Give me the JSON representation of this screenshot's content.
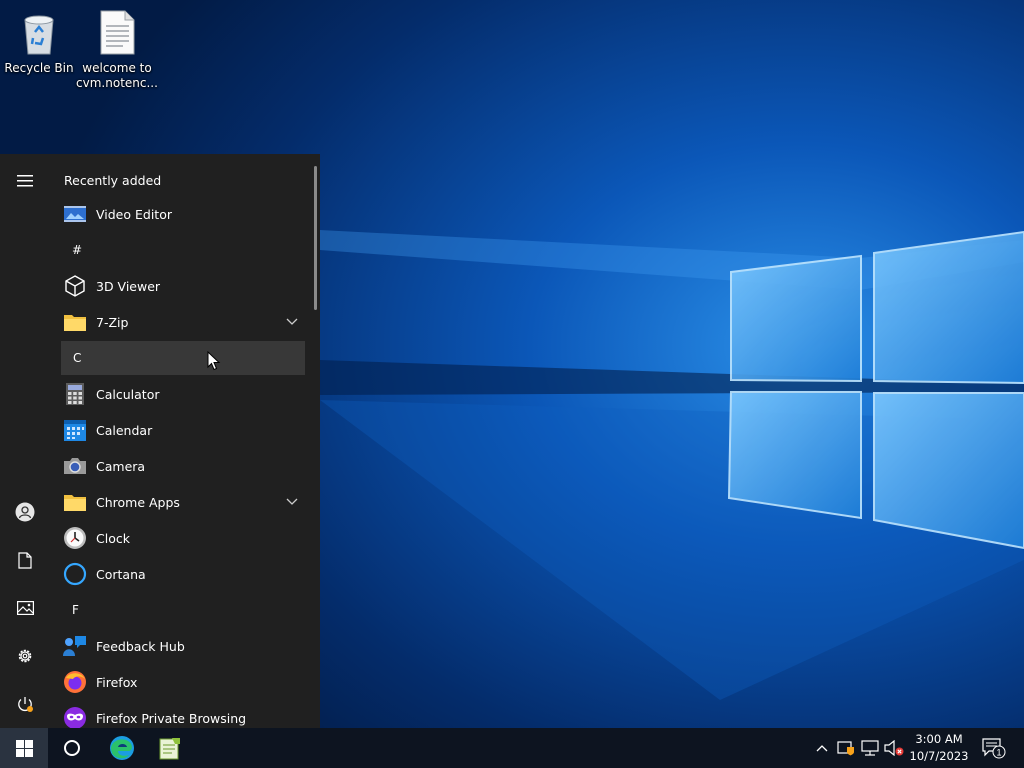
{
  "desktop": {
    "icons": [
      {
        "label": "Recycle Bin",
        "icon": "recycle-bin-icon"
      },
      {
        "label": "welcome to cvm.notenc...",
        "icon": "text-file-icon"
      }
    ]
  },
  "start_menu": {
    "rail": [
      {
        "icon": "hamburger-menu-icon"
      },
      {
        "icon": "user-account-icon"
      },
      {
        "icon": "documents-icon"
      },
      {
        "icon": "pictures-icon"
      },
      {
        "icon": "settings-gear-icon"
      },
      {
        "icon": "power-icon"
      }
    ],
    "recently_added_header": "Recently added",
    "items": [
      {
        "kind": "app",
        "name": "Video Editor",
        "icon": "video-editor-icon"
      },
      {
        "kind": "section",
        "letter": "#"
      },
      {
        "kind": "app",
        "name": "3D Viewer",
        "icon": "3d-viewer-icon"
      },
      {
        "kind": "folder",
        "name": "7-Zip",
        "icon": "folder-icon",
        "expandable": true
      },
      {
        "kind": "section",
        "letter": "C",
        "highlighted": true
      },
      {
        "kind": "app",
        "name": "Calculator",
        "icon": "calculator-icon"
      },
      {
        "kind": "app",
        "name": "Calendar",
        "icon": "calendar-icon"
      },
      {
        "kind": "app",
        "name": "Camera",
        "icon": "camera-icon"
      },
      {
        "kind": "folder",
        "name": "Chrome Apps",
        "icon": "folder-icon",
        "expandable": true
      },
      {
        "kind": "app",
        "name": "Clock",
        "icon": "clock-icon"
      },
      {
        "kind": "app",
        "name": "Cortana",
        "icon": "cortana-icon"
      },
      {
        "kind": "section",
        "letter": "F"
      },
      {
        "kind": "app",
        "name": "Feedback Hub",
        "icon": "feedback-hub-icon"
      },
      {
        "kind": "app",
        "name": "Firefox",
        "icon": "firefox-icon"
      },
      {
        "kind": "app",
        "name": "Firefox Private Browsing",
        "icon": "firefox-private-icon"
      }
    ]
  },
  "taskbar": {
    "buttons": [
      {
        "icon": "windows-start-icon"
      },
      {
        "icon": "cortana-search-icon"
      },
      {
        "icon": "edge-browser-icon"
      },
      {
        "icon": "notepad-plus-icon"
      }
    ],
    "tray": [
      {
        "icon": "show-hidden-icons-chevron-icon"
      },
      {
        "icon": "security-shield-icon"
      },
      {
        "icon": "network-icon"
      },
      {
        "icon": "volume-muted-icon"
      }
    ],
    "time": "3:00 AM",
    "date": "10/7/2023",
    "notification_count": "1",
    "colors": {
      "accent": "#0078d7",
      "taskbar": "#0d1420",
      "start_menu": "#202020"
    }
  }
}
